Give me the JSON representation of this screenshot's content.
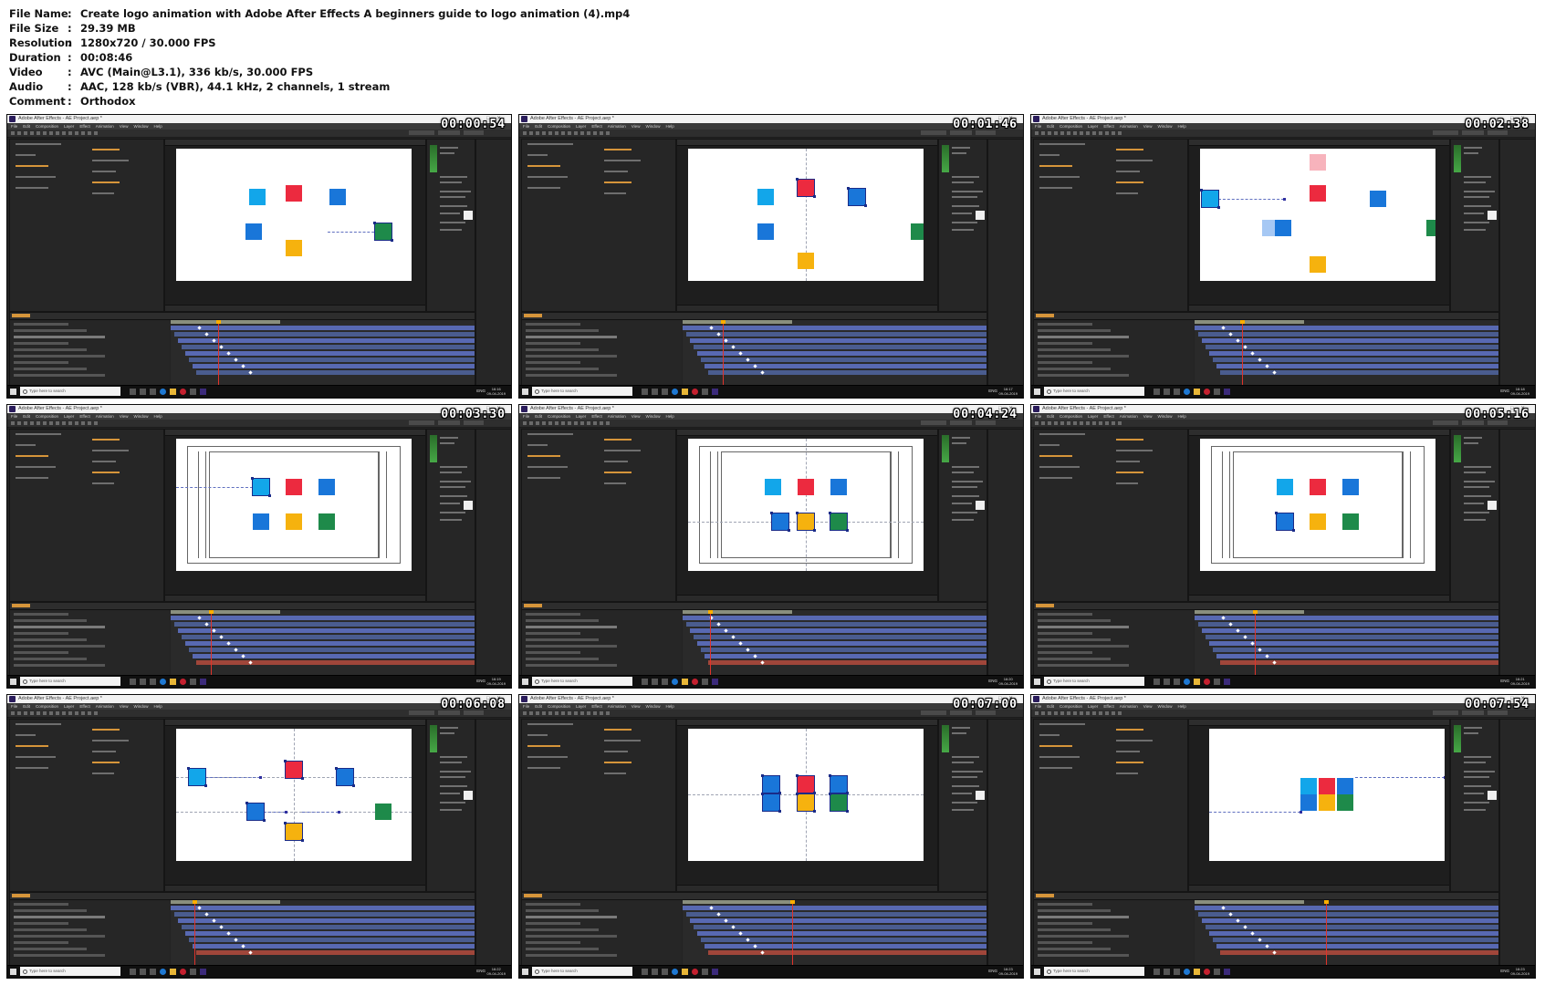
{
  "info": [
    {
      "key": "File Name",
      "value": "Create logo animation with Adobe After Effects  A beginners guide to logo animation (4).mp4"
    },
    {
      "key": "File Size",
      "value": "29.39 MB"
    },
    {
      "key": "Resolution",
      "value": "1280x720 / 30.000 FPS"
    },
    {
      "key": "Duration",
      "value": "00:08:46"
    },
    {
      "key": "Video",
      "value": "AVC (Main@L3.1), 336 kb/s, 30.000 FPS"
    },
    {
      "key": "Audio",
      "value": "AAC, 128 kb/s (VBR), 44.1 kHz, 2 channels, 1 stream"
    },
    {
      "key": "Comment",
      "value": "Orthodox"
    }
  ],
  "info_separator": ":",
  "app": {
    "window_title": "Adobe After Effects - AE Project.aep *",
    "menu": [
      "File",
      "Edit",
      "Composition",
      "Layer",
      "Effect",
      "Animation",
      "View",
      "Window",
      "Help"
    ],
    "search_placeholder": "Type here to search",
    "language": "ENG",
    "clock_times": [
      "16:16",
      "16:17",
      "16:18",
      "16:19",
      "16:20",
      "16:21",
      "16:22",
      "16:23",
      "16:23"
    ],
    "clock_date": "09-04-2019"
  },
  "timestamps": [
    "00:00:54",
    "00:01:46",
    "00:02:38",
    "00:03:30",
    "00:04:24",
    "00:05:16",
    "00:06:08",
    "00:07:00",
    "00:07:54"
  ],
  "colors": {
    "cyan": "#12a6ea",
    "red": "#ec2a3f",
    "blue": "#1976d9",
    "yellow": "#f6b20e",
    "green": "#1e8a4a"
  }
}
